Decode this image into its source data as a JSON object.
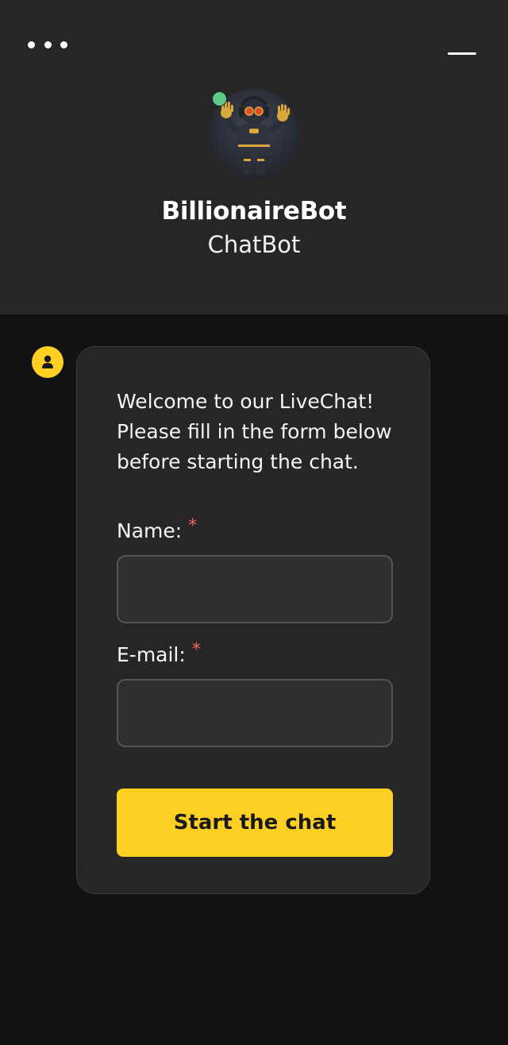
{
  "header": {
    "menu_icon": "more-horizontal-icon",
    "minimize_icon": "minimize-icon",
    "bot_name": "BillionaireBot",
    "bot_role": "ChatBot",
    "online": true,
    "online_color": "#5fc98a"
  },
  "agent": {
    "icon": "user-icon",
    "accent": "#fdd023"
  },
  "form": {
    "welcome": "Welcome to our LiveChat! Please fill in the form below before starting the chat.",
    "fields": [
      {
        "label": "Name:",
        "required_mark": "*",
        "value": ""
      },
      {
        "label": "E-mail:",
        "required_mark": "*",
        "value": ""
      }
    ],
    "submit_label": "Start the chat"
  },
  "colors": {
    "header_bg": "#262626",
    "body_bg": "#121212",
    "card_bg": "#262626",
    "accent": "#fdd023",
    "required": "#f06b5a"
  }
}
